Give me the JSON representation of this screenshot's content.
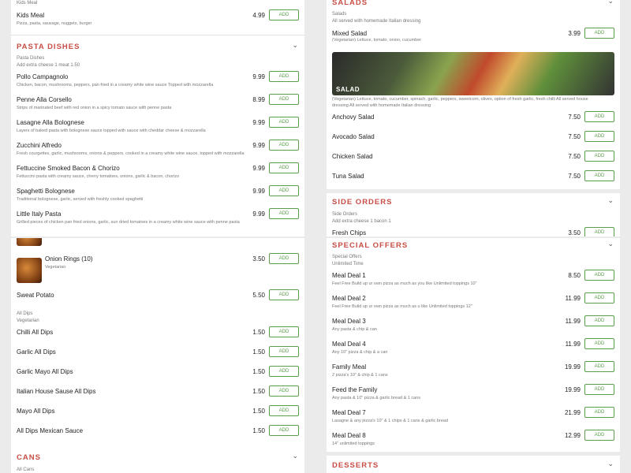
{
  "left_top": {
    "kids_meal_label": "Kids Meal",
    "kids_meal_item": {
      "name": "Kids Meal",
      "desc": "Pizza, pasta, sausage, nuggets, burger",
      "price": "4.99"
    },
    "pasta": {
      "title": "PASTA DISHES",
      "subtitle_name": "Pasta Dishes",
      "subtitle_desc": "Add extra cheese 1 meat 1.50",
      "items": [
        {
          "name": "Pollo Campagnolo",
          "desc": "Chicken, bacon, mushrooms, peppers, pan fried in a creamy white wine sauce Topped with mozzarella",
          "price": "9.99"
        },
        {
          "name": "Penne Alla Corsello",
          "desc": "Strips of marinated beef with red onion in a spicy tomato sauce with penne pasta",
          "price": "8.99"
        },
        {
          "name": "Lasagne Alla Bolognese",
          "desc": "Layers of baked pasta with bolognese sauce topped with sauce with cheddar cheese & mozzarella",
          "price": "9.99"
        },
        {
          "name": "Zucchini Alfredo",
          "desc": "Fresh courgettes, garlic, mushrooms, onions & peppers, cooked in a creamy white wine sauce, topped with mozzarella",
          "price": "9.99"
        },
        {
          "name": "Fettuccine Smoked Bacon & Chorizo",
          "desc": "Fettuccini pasta with creamy sauce, cherry tomatoes, onions, garlic & bacon, chorizo",
          "price": "9.99"
        },
        {
          "name": "Spaghetti Bolognese",
          "desc": "Traditional bolognese, garlic, served with freshly cooked spaghetti",
          "price": "9.99"
        },
        {
          "name": "Little Italy Pasta",
          "desc": "Grilled pieces of chicken pan fried onions, garlic, sun dried tomatoes in a creamy white wine sauce with penne pasta",
          "price": "9.99"
        }
      ]
    }
  },
  "left_bottom": {
    "onion_rings": {
      "name": "Onion Rings (10)",
      "desc": "Vegetarian",
      "price": "3.50"
    },
    "sweat_potato": {
      "name": "Sweat Potato",
      "price": "5.50"
    },
    "dips_sub_name": "All Dips",
    "dips_sub_desc": "Vegetarian",
    "dips": [
      {
        "name": "Chilli All Dips",
        "price": "1.50"
      },
      {
        "name": "Garlic All Dips",
        "price": "1.50"
      },
      {
        "name": "Garlic Mayo All Dips",
        "price": "1.50"
      },
      {
        "name": "Italian House Sause All Dips",
        "price": "1.50"
      },
      {
        "name": "Mayo All Dips",
        "price": "1.50"
      },
      {
        "name": "All Dips Mexican Sauce",
        "price": "1.50"
      }
    ],
    "cans_title": "CANS",
    "cans_sub": "All Cans"
  },
  "right_top": {
    "salads": {
      "title": "SALADS",
      "subtitle_name": "Salads",
      "subtitle_desc": "All served with homemade Italian dressing",
      "mixed": {
        "name": "Mixed Salad",
        "desc": "(Vegetarian) Lettuce, tomato, onion, cucumber",
        "price": "3.99"
      },
      "banner_label": "SALAD",
      "banner_desc": "(Vegetarian) Lettuce, tomato, cucumber, spinach, garlic, peppers, sweetcorn, olives, option of fresh garlic, fresh chilli All served house dressing All served with homemade Italian dressing",
      "items": [
        {
          "name": "Anchovy Salad",
          "price": "7.50"
        },
        {
          "name": "Avocado Salad",
          "price": "7.50"
        },
        {
          "name": "Chicken Salad",
          "price": "7.50"
        },
        {
          "name": "Tuna Salad",
          "price": "7.50"
        }
      ]
    },
    "side_orders": {
      "title": "SIDE ORDERS",
      "subtitle_name": "Side Orders",
      "subtitle_desc": "Add extra cheese 1 bacon 1",
      "fresh_chips": {
        "name": "Fresh Chips",
        "price": "3.50"
      }
    }
  },
  "right_bottom": {
    "special": {
      "title": "SPECIAL OFFERS",
      "subtitle_name": "Special Offers",
      "subtitle_desc": "Unlimited Time",
      "items": [
        {
          "name": "Meal Deal 1",
          "desc": "Feel Free Build up ur own pizza as much as you like Unlimited toppings 10\"",
          "price": "8.50"
        },
        {
          "name": "Meal Deal 2",
          "desc": "Feel Free Build up ur own pizza as much as u like Unlimited toppings 12\"",
          "price": "11.99"
        },
        {
          "name": "Meal Deal 3",
          "desc": "Any pasta & chip & can",
          "price": "11.99"
        },
        {
          "name": "Meal Deal 4",
          "desc": "Any 10\" pizza & chip & a can",
          "price": "11.99"
        },
        {
          "name": "Family Meal",
          "desc": "2 pizza's 10\" & chip & 1 cans",
          "price": "19.99"
        },
        {
          "name": "Feed the Family",
          "desc": "Any pasta & 10\" pizza & garlic bread & 1 cans",
          "price": "19.99"
        },
        {
          "name": "Meal Deal 7",
          "desc": "Lasagne & any pizza's 10\" & 1 chips & 1 cans & garlic bread",
          "price": "21.99"
        },
        {
          "name": "Meal Deal 8",
          "desc": "14\" unlimited toppings",
          "price": "12.99"
        }
      ]
    },
    "desserts_title": "DESSERTS"
  },
  "add_label": "ADD",
  "chevron_glyph": "⌄"
}
